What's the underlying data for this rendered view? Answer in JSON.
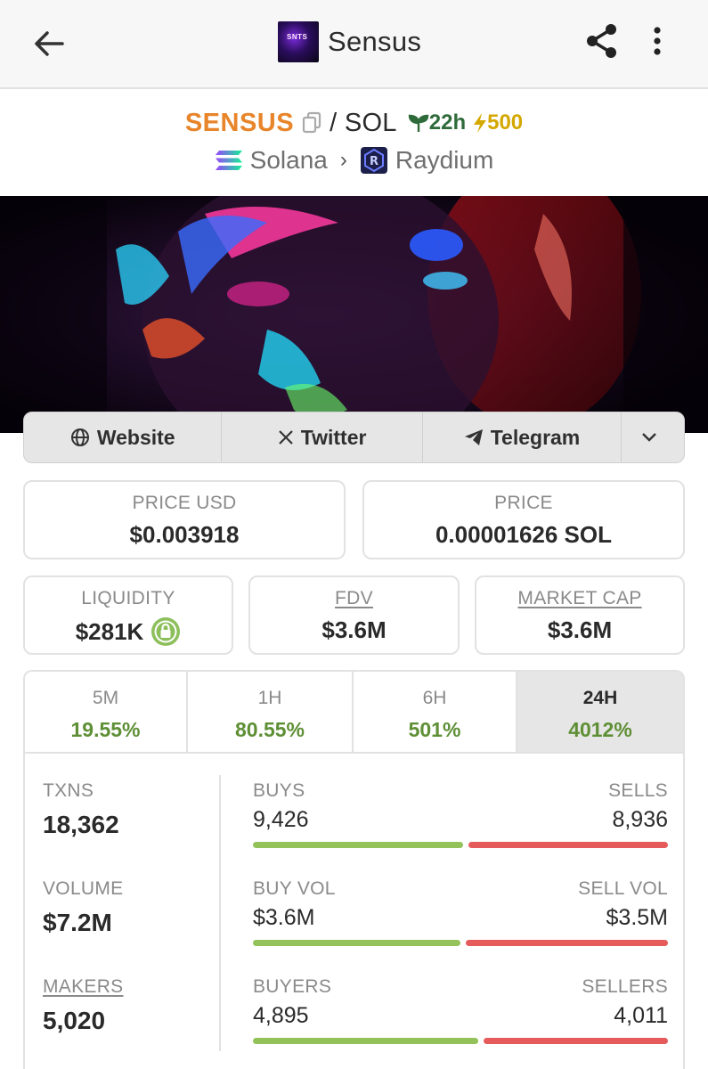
{
  "appbar": {
    "title": "Sensus",
    "avatar_text": "SNTS"
  },
  "pair": {
    "base": "SENSUS",
    "separator": "/",
    "quote": "SOL",
    "age": "22h",
    "boost": "500",
    "chain": "Solana",
    "dex": "Raydium"
  },
  "socials": {
    "website": "Website",
    "twitter": "Twitter",
    "telegram": "Telegram"
  },
  "stats": {
    "price_usd_label": "PRICE USD",
    "price_usd": "$0.003918",
    "price_label": "PRICE",
    "price_native": "0.00001626 SOL",
    "liquidity_label": "LIQUIDITY",
    "liquidity": "$281K",
    "fdv_label": "FDV",
    "fdv": "$3.6M",
    "mcap_label": "MARKET CAP",
    "mcap": "$3.6M"
  },
  "timeframes": [
    {
      "label": "5M",
      "change": "19.55%"
    },
    {
      "label": "1H",
      "change": "80.55%"
    },
    {
      "label": "6H",
      "change": "501%"
    },
    {
      "label": "24H",
      "change": "4012%"
    }
  ],
  "activity": {
    "txns_label": "TXNS",
    "txns": "18,362",
    "volume_label": "VOLUME",
    "volume": "$7.2M",
    "makers_label": "MAKERS",
    "makers": "5,020",
    "buys_label": "BUYS",
    "buys": "9,426",
    "sells_label": "SELLS",
    "sells": "8,936",
    "buy_share": 0.513,
    "buyvol_label": "BUY VOL",
    "buyvol": "$3.6M",
    "sellvol_label": "SELL VOL",
    "sellvol": "$3.5M",
    "buyvol_share": 0.507,
    "buyers_label": "BUYERS",
    "buyers": "4,895",
    "sellers_label": "SELLERS",
    "sellers": "4,011",
    "buyers_share": 0.55
  },
  "colors": {
    "base_symbol": "#e8852a",
    "positive": "#5e8f35",
    "buy_bar": "#93c25a",
    "sell_bar": "#e55a5a",
    "boost": "#d4a800"
  }
}
